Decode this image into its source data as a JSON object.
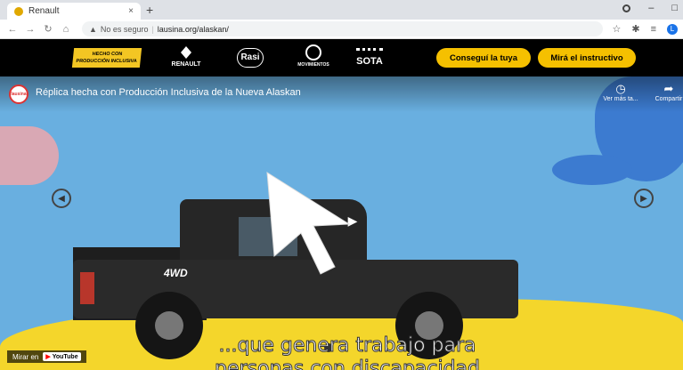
{
  "browser": {
    "tab_title": "Renault",
    "tab_close": "×",
    "new_tab": "+",
    "window_controls": [
      "–",
      "□"
    ],
    "security_label": "No es seguro",
    "url": "lausina.org/alaskan/",
    "profile_initial": "L"
  },
  "site_header": {
    "badge_line1": "HECHO CON",
    "badge_line2": "PRODUCCIÓN INCLUSIVA",
    "renault_label": "RENAULT",
    "rasi_label": "Rasi",
    "globe_label": "MOVIMIENTOS",
    "sota_label": "SOTA",
    "btn_get": "Conseguí la tuya",
    "btn_manual": "Mirá el instructivo"
  },
  "video": {
    "channel_logo": "lausina",
    "title": "Réplica hecha con Producción Inclusiva de la Nueva Alaskan",
    "watch_later": "Ver más ta...",
    "share": "Compartir",
    "truck_badge": "4WD",
    "subtitle_line1": "...que genera trabajo para",
    "subtitle_line2": "personas con discapacidad",
    "watch_on": "Mirar en",
    "youtube": "YouTube"
  },
  "colors": {
    "sky": "#69afe0",
    "accent_yellow": "#f5c000",
    "header_bg": "#000000",
    "blob": "#3c7bd0"
  }
}
